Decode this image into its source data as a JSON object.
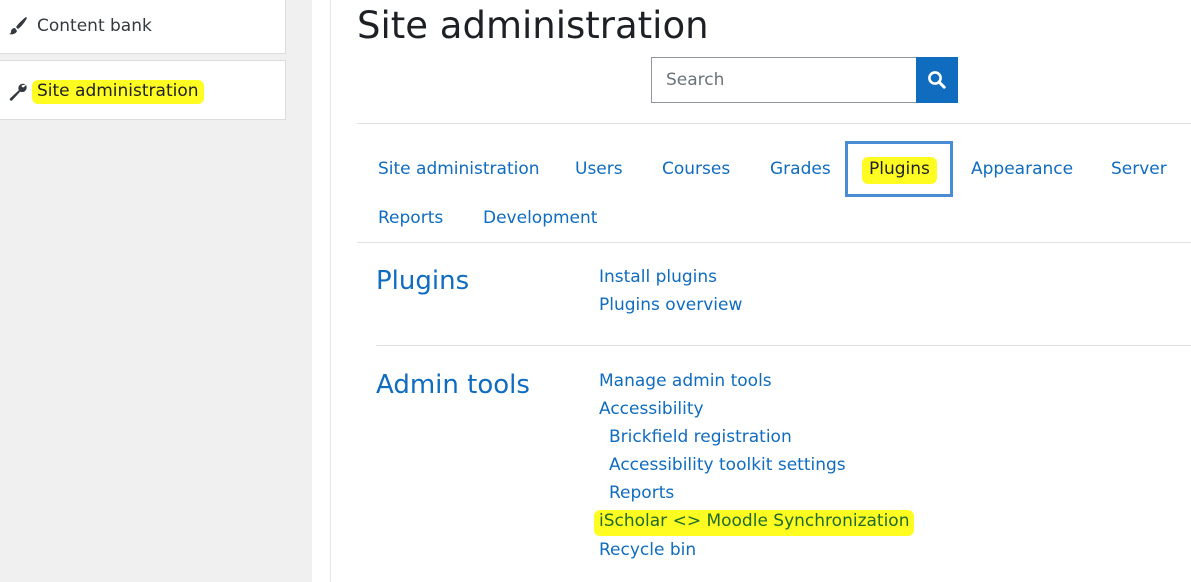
{
  "sidebar": {
    "items": [
      {
        "label": "Content bank",
        "icon": "paintbrush-icon"
      },
      {
        "label": "Site administration",
        "icon": "wrench-icon",
        "highlighted": true
      }
    ]
  },
  "page": {
    "title": "Site administration"
  },
  "search": {
    "placeholder": "Search",
    "button_icon": "search-icon"
  },
  "tabs": [
    {
      "label": "Site administration"
    },
    {
      "label": "Users"
    },
    {
      "label": "Courses"
    },
    {
      "label": "Grades"
    },
    {
      "label": "Plugins",
      "active": true
    },
    {
      "label": "Appearance"
    },
    {
      "label": "Server"
    },
    {
      "label": "Reports"
    },
    {
      "label": "Development"
    }
  ],
  "sections": [
    {
      "heading": "Plugins",
      "links": [
        {
          "label": "Install plugins"
        },
        {
          "label": "Plugins overview"
        }
      ]
    },
    {
      "heading": "Admin tools",
      "links": [
        {
          "label": "Manage admin tools"
        },
        {
          "label": "Accessibility"
        },
        {
          "label": "Brickfield registration"
        },
        {
          "label": "Accessibility toolkit settings"
        },
        {
          "label": "Reports"
        },
        {
          "label": "iScholar <> Moodle Synchronization",
          "highlighted": true
        },
        {
          "label": "Recycle bin"
        }
      ]
    }
  ],
  "colors": {
    "link": "#0f6cbf",
    "highlight": "#fffc22",
    "active_tab_border": "#4a8cd3",
    "sidebar_bg": "#f0f0f0"
  }
}
